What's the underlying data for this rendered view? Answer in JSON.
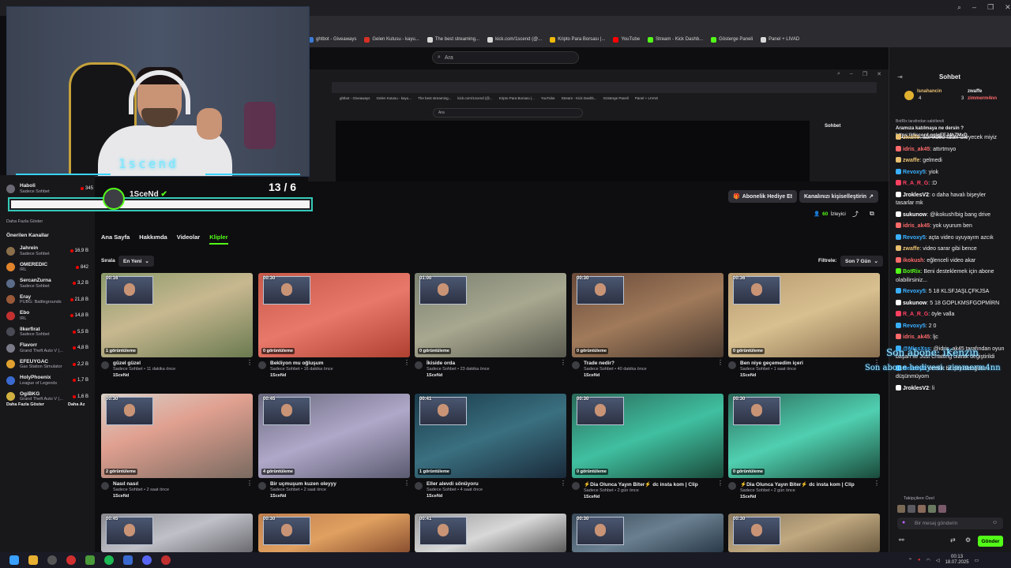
{
  "browser": {
    "bookmarks": [
      {
        "label": "ghtbot - Giveaways",
        "color": "#3a7bd5"
      },
      {
        "label": "Gelen Kutusu - kayu...",
        "color": "#d93025"
      },
      {
        "label": "The best streaming...",
        "color": "#d8d8d8"
      },
      {
        "label": "kick.com/1scend (@...",
        "color": "#d8d8d8"
      },
      {
        "label": "Kripto Para Borsası |...",
        "color": "#f0b90b"
      },
      {
        "label": "YouTube",
        "color": "#ff0000"
      },
      {
        "label": "Stream - Kick Dashb...",
        "color": "#53fc18"
      },
      {
        "label": "Gösterge Paneli",
        "color": "#53fc18"
      },
      {
        "label": "Panel + LIVAD",
        "color": "#d8d8d8"
      }
    ],
    "search_placeholder": "Ara"
  },
  "nested": {
    "bookmarks": [
      "ghtbot - Giveaways",
      "Gelen Kutusu - kayu...",
      "The best streaming...",
      "kick.com/1scend (@...",
      "Kripto Para Borsası |...",
      "YouTube",
      "Stream - Kick Dashb...",
      "Gösterge Paneli",
      "Panel + LIVAD"
    ],
    "search": "Ara",
    "chat_title": "Sohbet"
  },
  "overlay": {
    "cam_logo": "1scend",
    "counter": "13 / 6"
  },
  "sidebar": {
    "top_item": {
      "name": "Sadece Sohbet",
      "viewers": "345",
      "user": "Haboli"
    },
    "show_more_top": "Daha Fazla Göster",
    "recommended_title": "Önerilen Kanallar",
    "channels": [
      {
        "name": "Jahrein",
        "game": "Sadece Sohbet",
        "viewers": "16,9 B",
        "color": "#8a6f4a"
      },
      {
        "name": "OMEREDIC",
        "game": "IRL",
        "viewers": "842",
        "color": "#e0832b"
      },
      {
        "name": "SercanZurna",
        "game": "Sadece Sohbet",
        "viewers": "3,2 B",
        "color": "#5a6c8a"
      },
      {
        "name": "Eray",
        "game": "PUBG: Battlegrounds",
        "viewers": "21,8 B",
        "color": "#9a5a3a"
      },
      {
        "name": "Ebo",
        "game": "IRL",
        "viewers": "14,8 B",
        "color": "#c23030"
      },
      {
        "name": "llkerfirat",
        "game": "Sadece Sohbet",
        "viewers": "5,5 B",
        "color": "#4a4a55"
      },
      {
        "name": "Flavorr",
        "game": "Grand Theft Auto V (...",
        "viewers": "4,8 B",
        "color": "#7a7a88"
      },
      {
        "name": "EFEUYGAC",
        "game": "Gas Station Simulator",
        "viewers": "2,2 B",
        "color": "#e0a030"
      },
      {
        "name": "HolyPhoenix",
        "game": "League of Legends",
        "viewers": "1,7 B",
        "color": "#3a6ad0"
      },
      {
        "name": "OgiBKG",
        "game": "Grand Theft Auto V (...",
        "viewers": "1,6 B",
        "color": "#d0b040"
      }
    ],
    "show_more": "Daha Fazla Göster",
    "show_less": "Daha Az"
  },
  "channel": {
    "name": "1SceNd",
    "gift_button": "Abonelik Hediye Et",
    "customize_button": "Kanalınızı kişiselleştirin",
    "viewers_count": "60",
    "viewers_label": "İzleyici",
    "tabs": [
      "Ana Sayfa",
      "Hakkımda",
      "Videolar",
      "Klipler"
    ],
    "active_tab": 3,
    "sort_label": "Sırala",
    "sort_value": "En Yeni",
    "filter_label": "Filtrele:",
    "filter_value": "Son 7 Gün"
  },
  "clips": [
    {
      "duration": "00:16",
      "views": "1 görüntüleme",
      "title": "güzel güzel",
      "meta": "Sadece Sohbet • 11 dakika önce",
      "channel": "1SceNd",
      "bg": "linear-gradient(160deg,#8a9a6a 0%,#c8b890 45%,#6a7a50 100%)"
    },
    {
      "duration": "00:30",
      "views": "0 görüntüleme",
      "title": "Bekliyon mu oğluşum",
      "meta": "Sadece Sohbet • 16 dakika önce",
      "channel": "1SceNd",
      "bg": "linear-gradient(160deg,#c85a4a 0%,#e8786a 50%,#b04030 100%)"
    },
    {
      "duration": "01:00",
      "views": "0 görüntüleme",
      "title": "İkiside orda",
      "meta": "Sadece Sohbet • 23 dakika önce",
      "channel": "1SceNd",
      "bg": "linear-gradient(160deg,#7a8070 0%,#a8a890 50%,#5a5a50 100%)"
    },
    {
      "duration": "00:30",
      "views": "0 görüntüleme",
      "title": "Trade nedir?",
      "meta": "Sadece Sohbet • 40 dakika önce",
      "channel": "1SceNd",
      "bg": "linear-gradient(160deg,#6a4a3a 0%,#a07a5a 50%,#4a3a30 100%)"
    },
    {
      "duration": "00:36",
      "views": "0 görüntüleme",
      "title": "Ben niye geçemedim içeri",
      "meta": "Sadece Sohbet • 1 saat önce",
      "channel": "1SceNd",
      "bg": "linear-gradient(160deg,#b89a70 0%,#d8c090 50%,#8a7050 100%)"
    },
    {
      "duration": "00:30",
      "views": "2 görüntüleme",
      "title": "Nasıl nasıl",
      "meta": "Sadece Sohbet • 2 saat önce",
      "channel": "1SceNd",
      "bg": "linear-gradient(160deg,#d8d0c8 0%,#e0a090 40%,#7a6a60 100%)"
    },
    {
      "duration": "00:45",
      "views": "4 görüntüleme",
      "title": "Bir uçmuşum kuzen oleyyy",
      "meta": "Sadece Sohbet • 2 saat önce",
      "channel": "1SceNd",
      "bg": "linear-gradient(160deg,#6a6a80 0%,#b0a8c8 50%,#5a5a70 100%)"
    },
    {
      "duration": "00:41",
      "views": "1 görüntüleme",
      "title": "Eller alevdi sönüyoru",
      "meta": "Sadece Sohbet • 4 saat önce",
      "channel": "1SceNd",
      "bg": "linear-gradient(160deg,#1a3a4a 0%,#3a7080 50%,#1a2a3a 100%)"
    },
    {
      "duration": "00:30",
      "views": "0 görüntüleme",
      "title": "⚡Dia Olunca Yayın Biter⚡ dc insta kom | Clip",
      "meta": "Sadece Sohbet • 2 gün önce",
      "channel": "1SceNd",
      "bg": "linear-gradient(160deg,#2a6a5a 0%,#40c0a0 50%,#1a4a3a 100%)"
    },
    {
      "duration": "00:30",
      "views": "0 görüntüleme",
      "title": "⚡Dia Olunca Yayın Biter⚡ dc insta kom | Clip",
      "meta": "Sadece Sohbet • 2 gün önce",
      "channel": "1SceNd",
      "bg": "linear-gradient(160deg,#2a6a5a 0%,#50d0b0 50%,#1a4a3a 100%)"
    },
    {
      "duration": "00:45",
      "views": "",
      "title": "",
      "meta": "",
      "channel": "",
      "bg": "linear-gradient(160deg,#8a8a90 0%,#c0c0c8 50%,#6a6a70 100%)"
    },
    {
      "duration": "00:30",
      "views": "",
      "title": "",
      "meta": "",
      "channel": "",
      "bg": "linear-gradient(160deg,#c08050 0%,#e0a060 50%,#8a5030 100%)"
    },
    {
      "duration": "00:41",
      "views": "",
      "title": "",
      "meta": "",
      "channel": "",
      "bg": "linear-gradient(160deg,#9a9a9a 0%,#d8d8d8 50%,#5a5a5a 100%)"
    },
    {
      "duration": "00:30",
      "views": "",
      "title": "",
      "meta": "",
      "channel": "",
      "bg": "linear-gradient(160deg,#3a4a5a 0%,#6a8090 50%,#2a3a4a 100%)"
    },
    {
      "duration": "00:30",
      "views": "",
      "title": "",
      "meta": "",
      "channel": "",
      "bg": "linear-gradient(160deg,#8a7a60 0%,#c0a880 50%,#6a5a40 100%)"
    }
  ],
  "chat": {
    "title": "Sohbet",
    "pinned": {
      "sub_gifter_1": "lsnahancin",
      "sub_gifter_1_count": "4",
      "user2": "zwaffe",
      "user3": "zimmerm4nn",
      "user3_count": "3"
    },
    "pinned_msg": {
      "by": "BotRix tarafından sabitlendi",
      "text": "Aramıza katılmaya ne dersin ?",
      "link": "https://discord.gg/gEEJ4hZMxD"
    },
    "messages": [
      {
        "user": "zwaffe",
        "color": "#e8c070",
        "text": "abi video falan izleyecek miyiz"
      },
      {
        "user": "idris_ak45",
        "color": "#ff6a6a",
        "text": "attırtmıyo"
      },
      {
        "user": "zwaffe",
        "color": "#e8c070",
        "text": "gelmedi"
      },
      {
        "user": "Revoxy5",
        "color": "#3ab0ff",
        "text": "yiok"
      },
      {
        "user": "R_A_R_G",
        "color": "#ff4060",
        "text": ":D"
      },
      {
        "user": "JroklesV2",
        "color": "#ffffff",
        "text": "o daha havalı bişeyler tasarlar mk"
      },
      {
        "user": "sukunow",
        "color": "#ffffff",
        "text": "@ikokush!big bang drive"
      },
      {
        "user": "idris_ak45",
        "color": "#ff6a6a",
        "text": "yok uyurum ben"
      },
      {
        "user": "Revoxy5",
        "color": "#3ab0ff",
        "text": "açta video uyuyayım azcık"
      },
      {
        "user": "zwaffe",
        "color": "#e8c070",
        "text": "video sarar gibi bence"
      },
      {
        "user": "ikokush",
        "color": "#ff6a6a",
        "text": "eğlenceli video akar"
      },
      {
        "user": "BotRix",
        "color": "#53fc18",
        "text": "Beni desteklemek için abone olabilirsiniz..."
      },
      {
        "user": "Revoxy5",
        "color": "#3ab0ff",
        "text": "5 18 KLSFJAŞLÇFKJSA"
      },
      {
        "user": "sukunow",
        "color": "#ffffff",
        "text": "5 18 GOPLKMSFGOPMİRN"
      },
      {
        "user": "R_A_R_G",
        "color": "#ff4060",
        "text": "öyle valla"
      },
      {
        "user": "Revoxy5",
        "color": "#3ab0ff",
        "text": "2 0"
      },
      {
        "user": "idris_ak45",
        "color": "#ff6a6a",
        "text": "ljc"
      },
      {
        "user": "@MissXss",
        "color": "#3ab0ff",
        "text": "@idris_ak45 tarafından oyun başarı ile Just Chatting olarak değiştirildi"
      },
      {
        "user": "Revoxy5",
        "color": "#3ab0ff",
        "text": "özetlik bir şey olduğunu düşünmüyom"
      },
      {
        "user": "JroklesV2",
        "color": "#ffffff",
        "text": "li"
      }
    ],
    "last_sub_1": "Son abone: iKenzin",
    "last_sub_2": "Son abone hediyesi: zimmerm4nn",
    "input_placeholder": "Bir mesaj gönderin",
    "send_label": "Gönder",
    "followers_label": "Takipçilere Özel"
  },
  "taskbar": {
    "time": "00:13",
    "date": "18.07.2025"
  }
}
